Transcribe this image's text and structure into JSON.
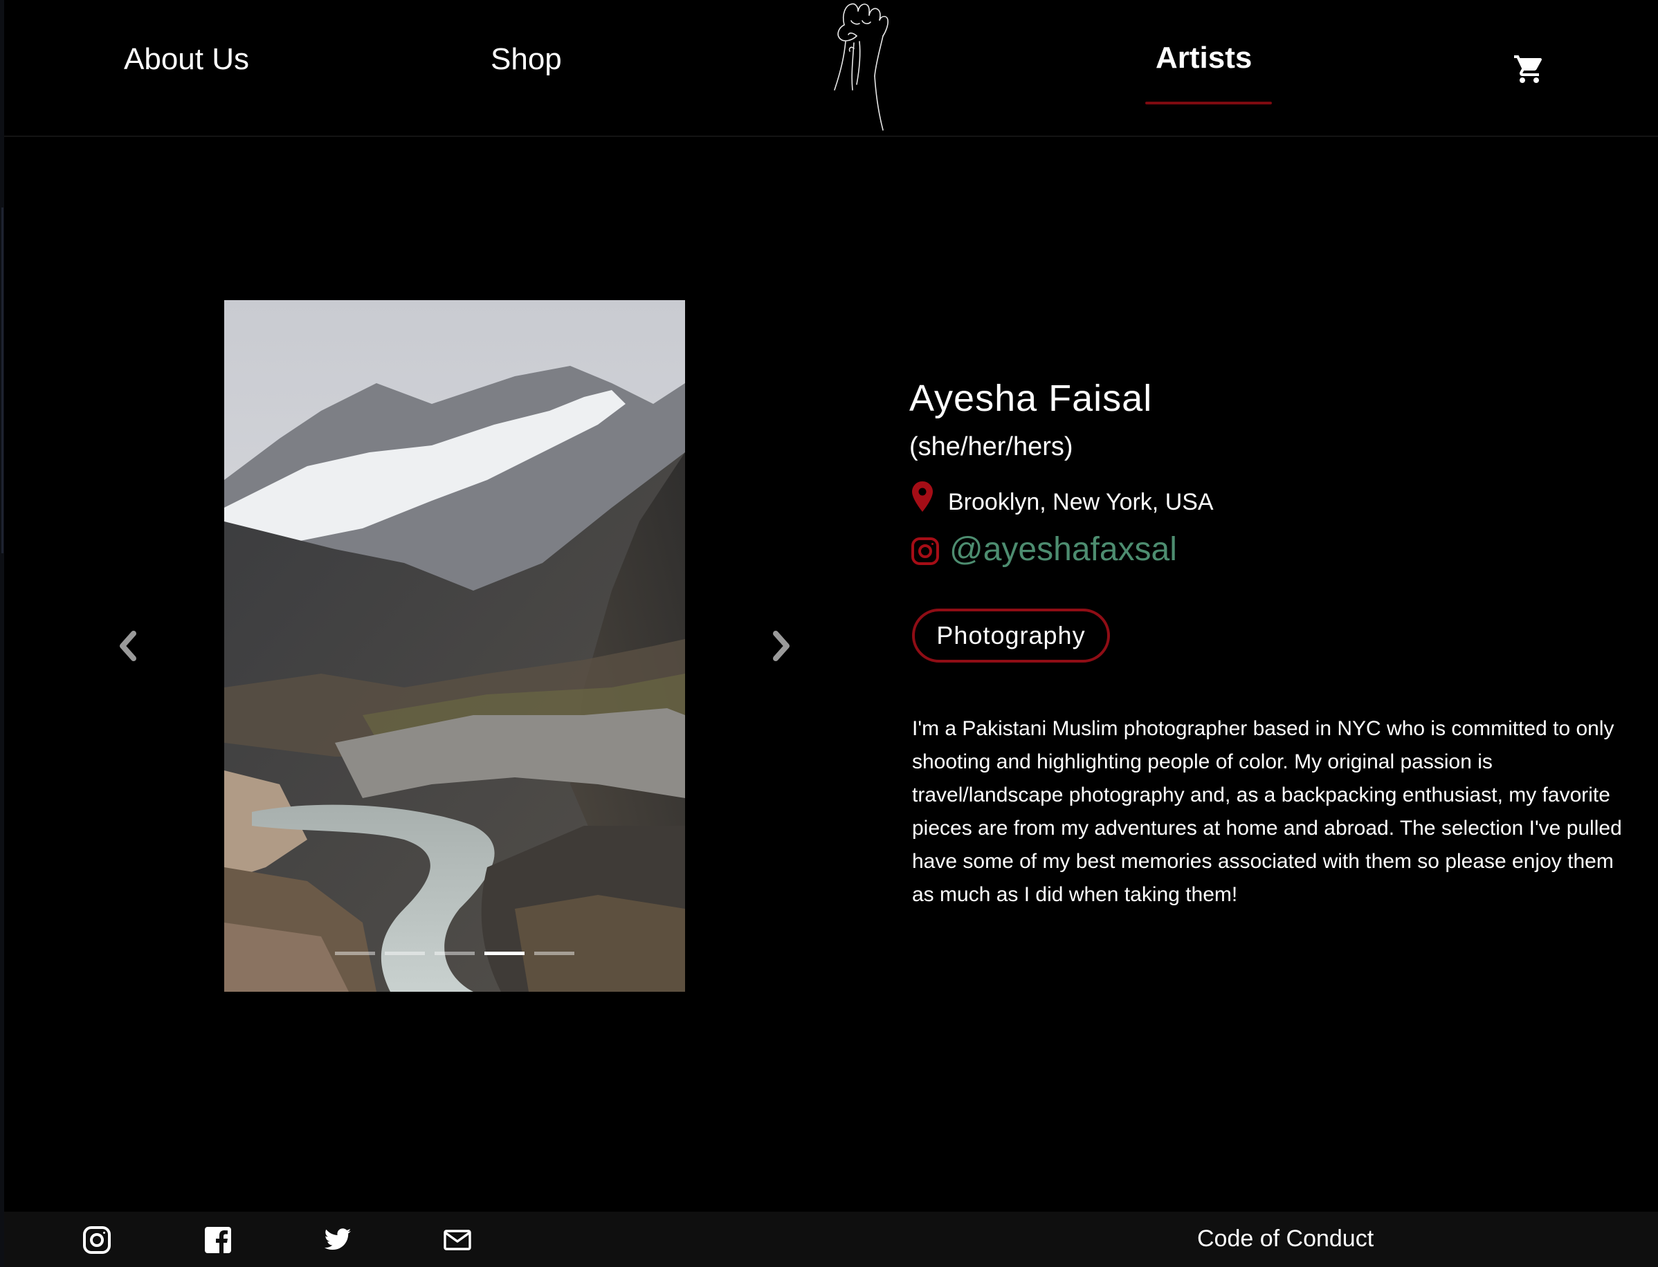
{
  "nav": {
    "about": "About Us",
    "shop": "Shop",
    "artists": "Artists"
  },
  "carousel": {
    "slide_count": 5,
    "active_index": 3
  },
  "artist": {
    "name": "Ayesha Faisal",
    "pronouns": "(she/her/hers)",
    "location": "Brooklyn, New York, USA",
    "instagram": "@ayeshafaxsal",
    "tag": "Photography",
    "bio": "I'm a Pakistani Muslim photographer based in NYC who is committed to only shooting and highlighting people of color. My original passion is travel/landscape photography and, as a backpacking enthusiast, my favorite pieces are from my adventures at home and abroad. The selection I've pulled have some of my best memories associated with them so please enjoy them as much as I did when taking them!"
  },
  "footer": {
    "code_of_conduct": "Code of Conduct",
    "icons": [
      "instagram-icon",
      "facebook-icon",
      "twitter-icon",
      "mail-icon"
    ]
  },
  "colors": {
    "background": "#000000",
    "accent_red": "#8f0d15",
    "instagram_handle": "#4d8d70",
    "footer_bg": "#0f0f0f"
  }
}
